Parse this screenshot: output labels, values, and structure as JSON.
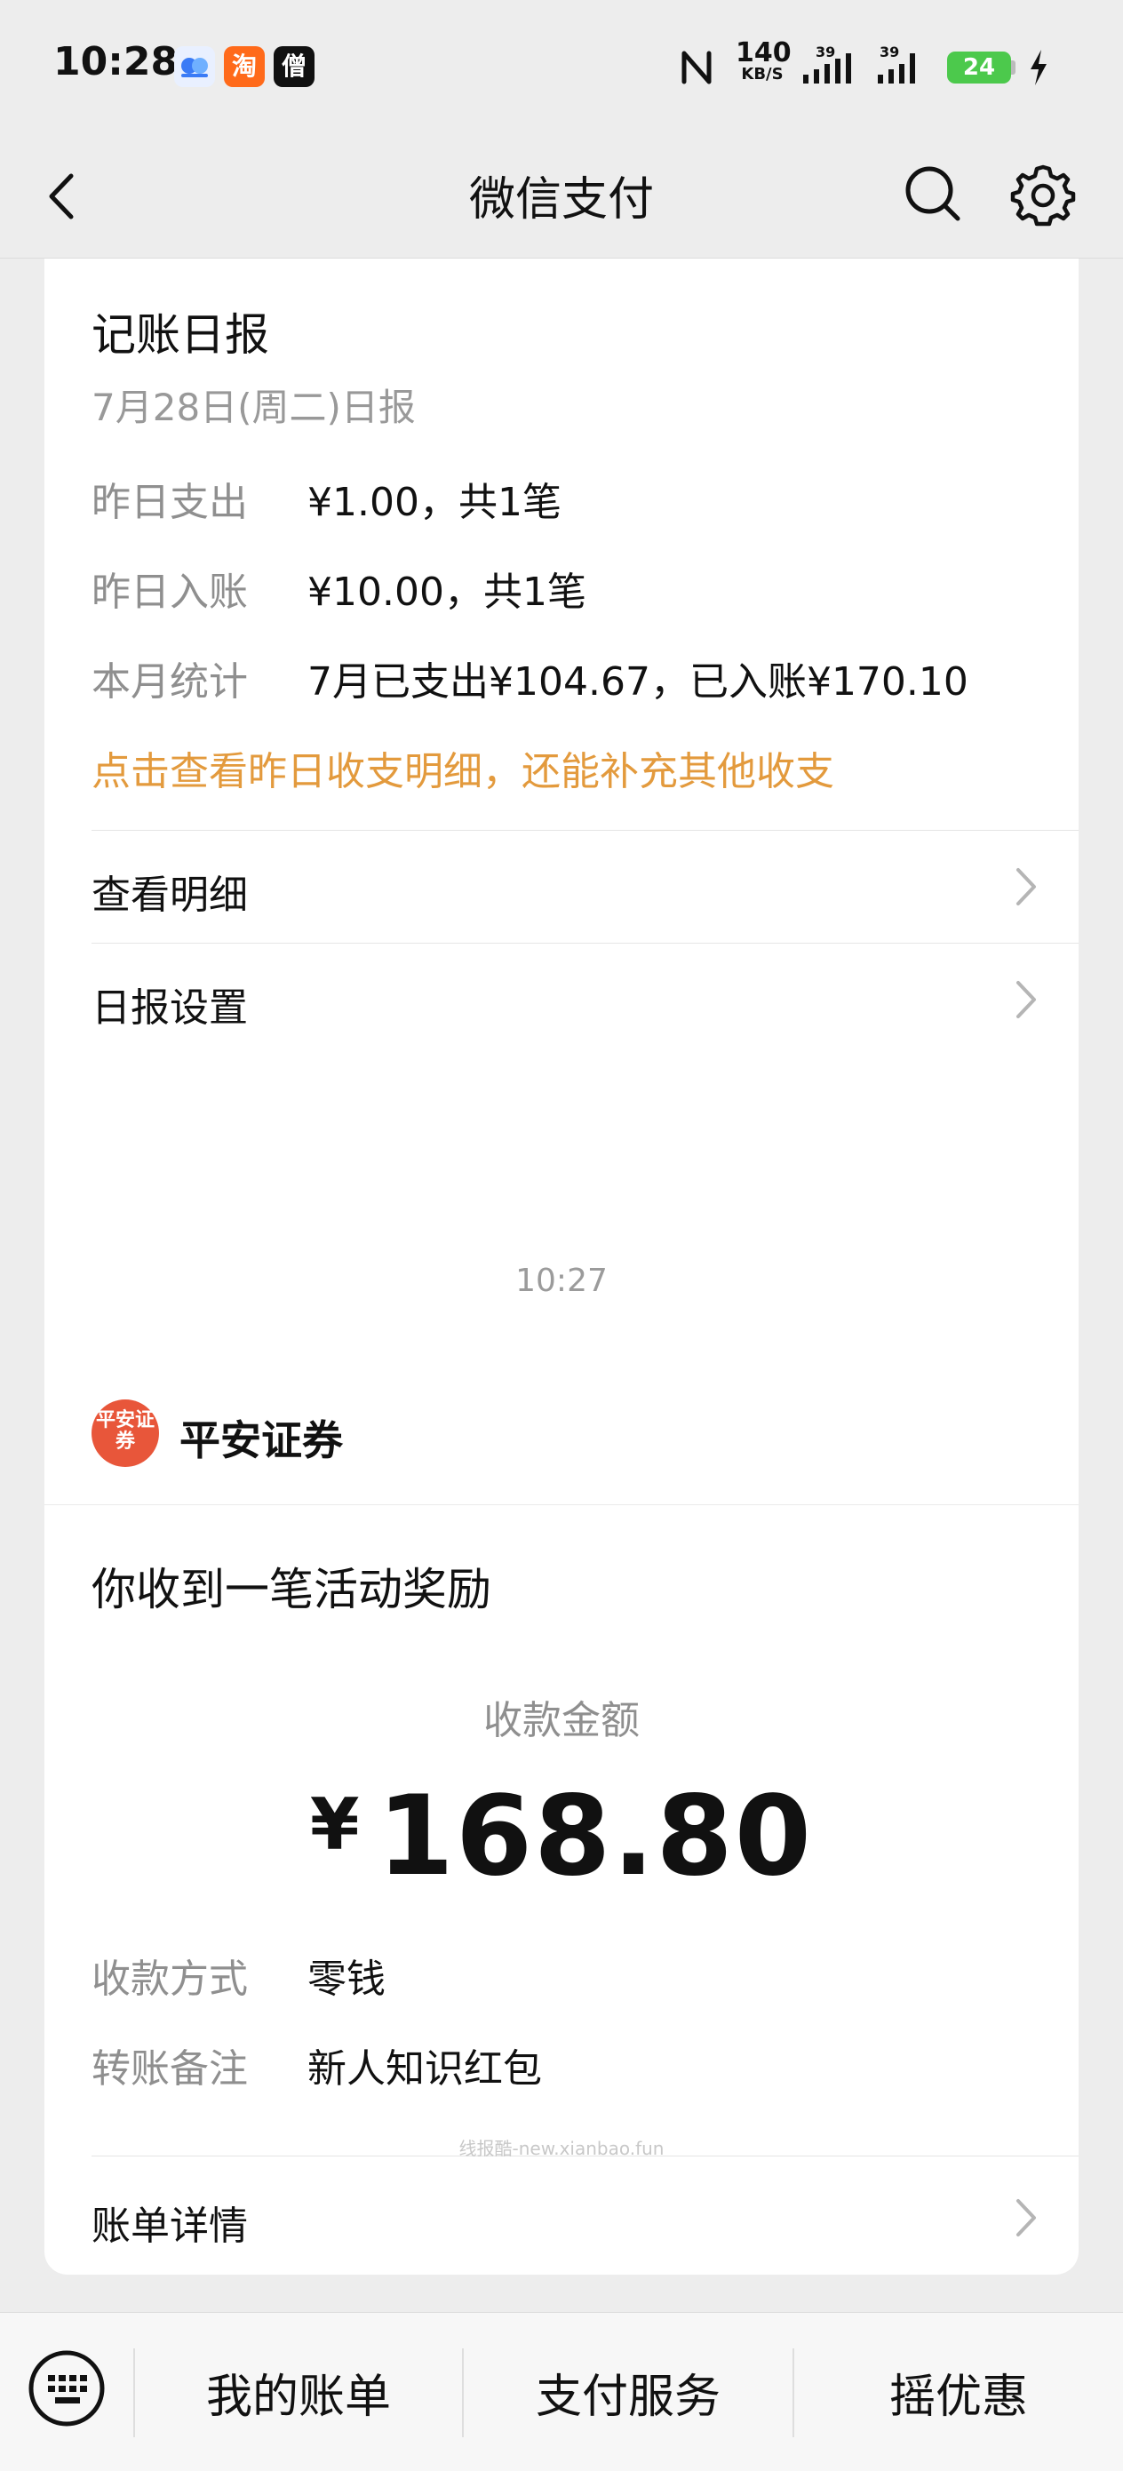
{
  "status_bar": {
    "time": "10:28",
    "app_icons": [
      {
        "icon": "baidu-netdisk-icon",
        "color": "#3a7bf6"
      },
      {
        "icon": "taobao-icon",
        "label": "淘",
        "color": "#ff6a1a"
      },
      {
        "icon": "news-app-icon",
        "label": "僧",
        "color": "#111111"
      }
    ],
    "net_speed_value": "140",
    "net_speed_unit": "KB/S",
    "signal_1_label": "39",
    "signal_2_label": "39",
    "battery": "24"
  },
  "nav": {
    "title": "微信支付"
  },
  "daily_report": {
    "title": "记账日报",
    "subtitle": "7月28日(周二)日报",
    "rows": [
      {
        "label": "昨日支出",
        "value": "¥1.00，共1笔"
      },
      {
        "label": "昨日入账",
        "value": "¥10.00，共1笔"
      },
      {
        "label": "本月统计",
        "value": "7月已支出¥104.67，已入账¥170.10"
      }
    ],
    "hint": "点击查看昨日收支明细，还能补充其他收支",
    "links": [
      {
        "label": "查看明细"
      },
      {
        "label": "日报设置"
      }
    ]
  },
  "timestamp": "10:27",
  "reward_card": {
    "brand_logo_text": "平安证券",
    "brand_name": "平安证券",
    "title": "你收到一笔活动奖励",
    "amount_label": "收款金额",
    "currency": "¥",
    "amount": "168.80",
    "rows": [
      {
        "label": "收款方式",
        "value": "零钱"
      },
      {
        "label": "转账备注",
        "value": "新人知识红包"
      }
    ],
    "watermark": "线报酷-new.xianbao.fun",
    "link_label": "账单详情"
  },
  "bottom_bar": {
    "tabs": [
      {
        "label": "我的账单"
      },
      {
        "label": "支付服务"
      },
      {
        "label": "摇优惠"
      }
    ]
  },
  "colors": {
    "accent_orange": "#e39a3d",
    "brand_red": "#e8563a",
    "battery_green": "#4cc94c"
  }
}
